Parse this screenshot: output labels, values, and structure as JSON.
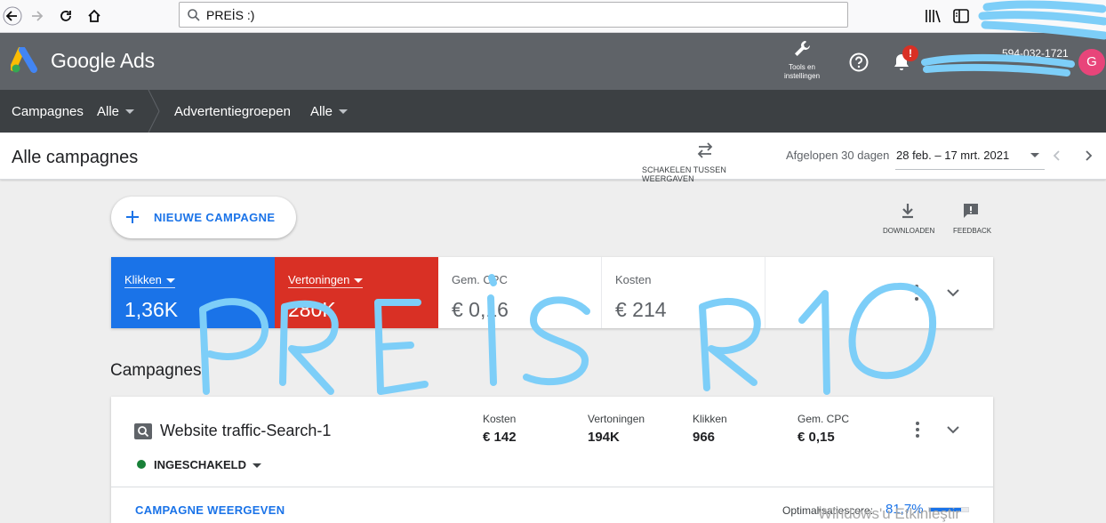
{
  "browser": {
    "url": "PREİS :)"
  },
  "header": {
    "brand": "Google Ads",
    "tools_label_line1": "Tools en",
    "tools_label_line2": "instellingen",
    "notification_badge": "!",
    "account_id": "594-032-1721",
    "avatar_letter": "G"
  },
  "subnav": {
    "campaigns_label": "Campagnes",
    "campaigns_filter": "Alle",
    "adgroups_label": "Advertentiegroepen",
    "adgroups_filter": "Alle"
  },
  "titlebar": {
    "title": "Alle campagnes",
    "switch_views": "SCHAKELEN TUSSEN WEERGAVEN",
    "date_preset": "Afgelopen 30 dagen",
    "date_range": "28 feb. – 17 mrt. 2021"
  },
  "actions": {
    "new_campaign": "NIEUWE CAMPAGNE",
    "download": "DOWNLOADEN",
    "feedback": "FEEDBACK"
  },
  "metrics": [
    {
      "label": "Klikken",
      "value": "1,36K",
      "bg": "#1a73e8",
      "fg": "#ffffff"
    },
    {
      "label": "Vertoningen",
      "value": "280K",
      "bg": "#d93025",
      "fg": "#ffffff"
    },
    {
      "label": "Gem. CPC",
      "value": "€ 0,16",
      "bg": "#ffffff",
      "fg": "#5f6368"
    },
    {
      "label": "Kosten",
      "value": "€ 214",
      "bg": "#ffffff",
      "fg": "#5f6368"
    }
  ],
  "campaigns_section": {
    "title": "Campagnes",
    "card": {
      "name": "Website traffic-Search-1",
      "status": "INGESCHAKELD",
      "stats": [
        {
          "label": "Kosten",
          "value": "€ 142"
        },
        {
          "label": "Vertoningen",
          "value": "194K"
        },
        {
          "label": "Klikken",
          "value": "966"
        },
        {
          "label": "Gem. CPC",
          "value": "€ 0,15"
        }
      ],
      "view_link": "CAMPAGNE WEERGEVEN",
      "optimization_label": "Optimalisatiescore:",
      "optimization_value": "81,7%",
      "optimization_fraction": 0.817
    }
  },
  "overlay": {
    "handwritten_text": "PREİS R10",
    "watermark": "Windows'u Etkinleştir"
  },
  "colors": {
    "accent": "#1a73e8",
    "clicks": "#1a73e8",
    "impressions": "#d93025",
    "status_enabled": "#188038",
    "scribble": "#7dcef8"
  }
}
